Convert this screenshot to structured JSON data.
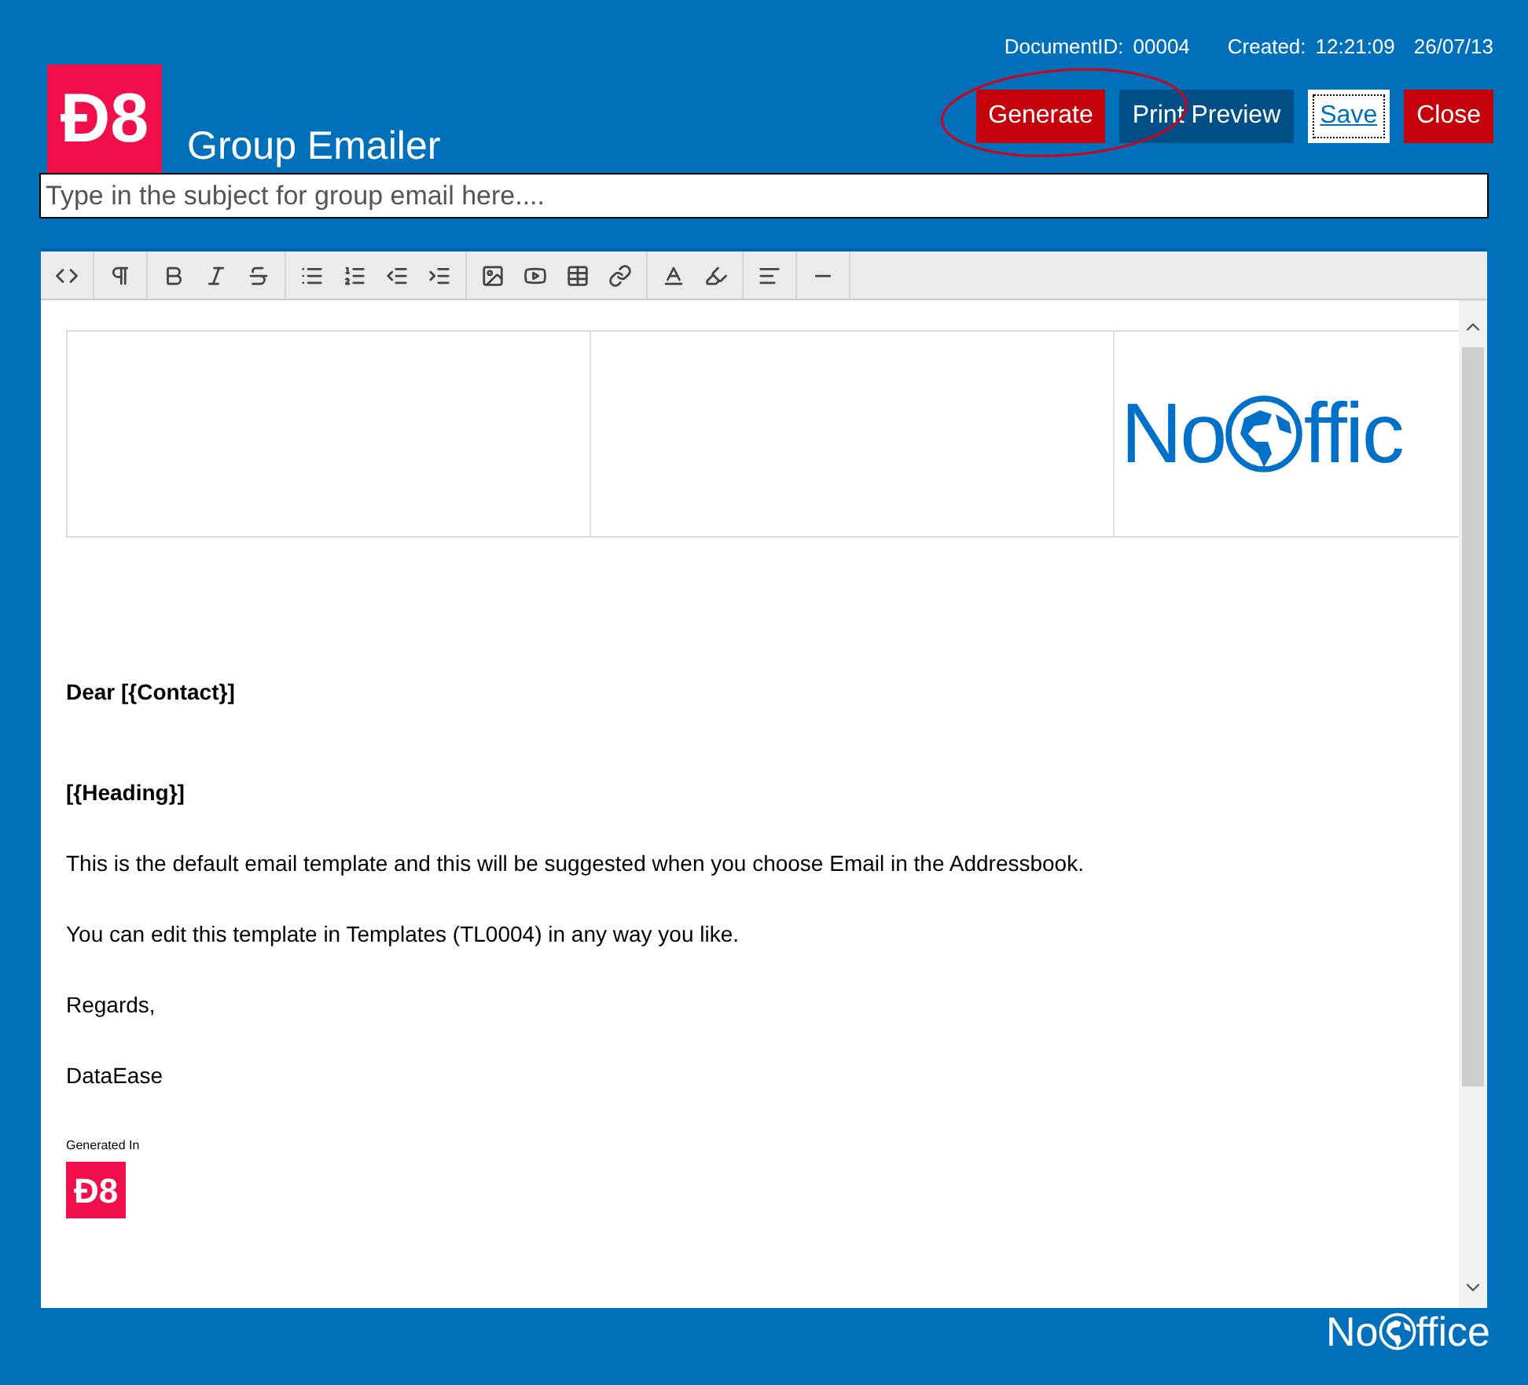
{
  "header": {
    "logo": "Đ8",
    "title": "Group Emailer",
    "document_id_label": "DocumentID:",
    "document_id": "00004",
    "created_label": "Created:",
    "created_time": "12:21:09",
    "created_date": "26/07/13",
    "buttons": [
      {
        "label": "Generate",
        "kind": "danger"
      },
      {
        "label": "Print Preview",
        "kind": "secondary"
      },
      {
        "label": "Save",
        "kind": "focused"
      },
      {
        "label": "Close",
        "kind": "danger"
      }
    ]
  },
  "subject": {
    "placeholder": "Type in the subject for group email here...."
  },
  "editor": {
    "banner_logo": {
      "before": "No",
      "after": "ffic"
    },
    "paragraphs": [
      {
        "kind": "greeting",
        "text": "Dear [{Contact}]"
      },
      {
        "kind": "heading",
        "text": "[{Heading}]"
      },
      {
        "kind": "paragraph",
        "text": "This is the default email template and this will be suggested when you choose Email in the Addressbook."
      },
      {
        "kind": "paragraph",
        "text": "You can edit this template in Templates (TL0004) in any way you like."
      },
      {
        "kind": "paragraph",
        "text": "Regards,"
      },
      {
        "kind": "paragraph",
        "text": "DataEase"
      }
    ],
    "footer_caption": "Generated In",
    "footer_logo": "Đ8"
  },
  "footer": {
    "logo": {
      "before": "No",
      "after": "ffice"
    }
  }
}
